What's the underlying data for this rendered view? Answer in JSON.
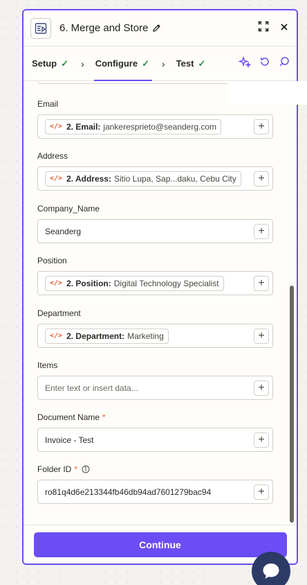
{
  "header": {
    "title": "6. Merge and Store"
  },
  "tabs": [
    {
      "label": "Setup",
      "check": "✓"
    },
    {
      "label": "Configure",
      "check": "✓"
    },
    {
      "label": "Test",
      "check": "✓"
    }
  ],
  "fields": {
    "email": {
      "label": "Email",
      "pill_key": "2. Email:",
      "pill_value": "jankeresprieto@seanderg.com"
    },
    "address": {
      "label": "Address",
      "pill_key": "2. Address:",
      "pill_value": "Sitio Lupa, Sap...daku, Cebu City"
    },
    "company_name": {
      "label": "Company_Name",
      "value": "Seanderg"
    },
    "position": {
      "label": "Position",
      "pill_key": "2. Position:",
      "pill_value": "Digital Technology Specialist"
    },
    "department": {
      "label": "Department",
      "pill_key": "2. Department:",
      "pill_value": "Marketing"
    },
    "items": {
      "label": "Items",
      "placeholder": "Enter text or insert data..."
    },
    "document_name": {
      "label": "Document Name",
      "required_mark": "*",
      "value": "Invoice - Test"
    },
    "folder_id": {
      "label": "Folder ID",
      "required_mark": "*",
      "value": "ro81q4d6e213344fb46db94ad7601279bac94"
    }
  },
  "footer": {
    "continue_label": "Continue"
  },
  "colors": {
    "accent": "#6b4df5",
    "code_icon": "#e5582a",
    "check": "#2e8a4a"
  }
}
